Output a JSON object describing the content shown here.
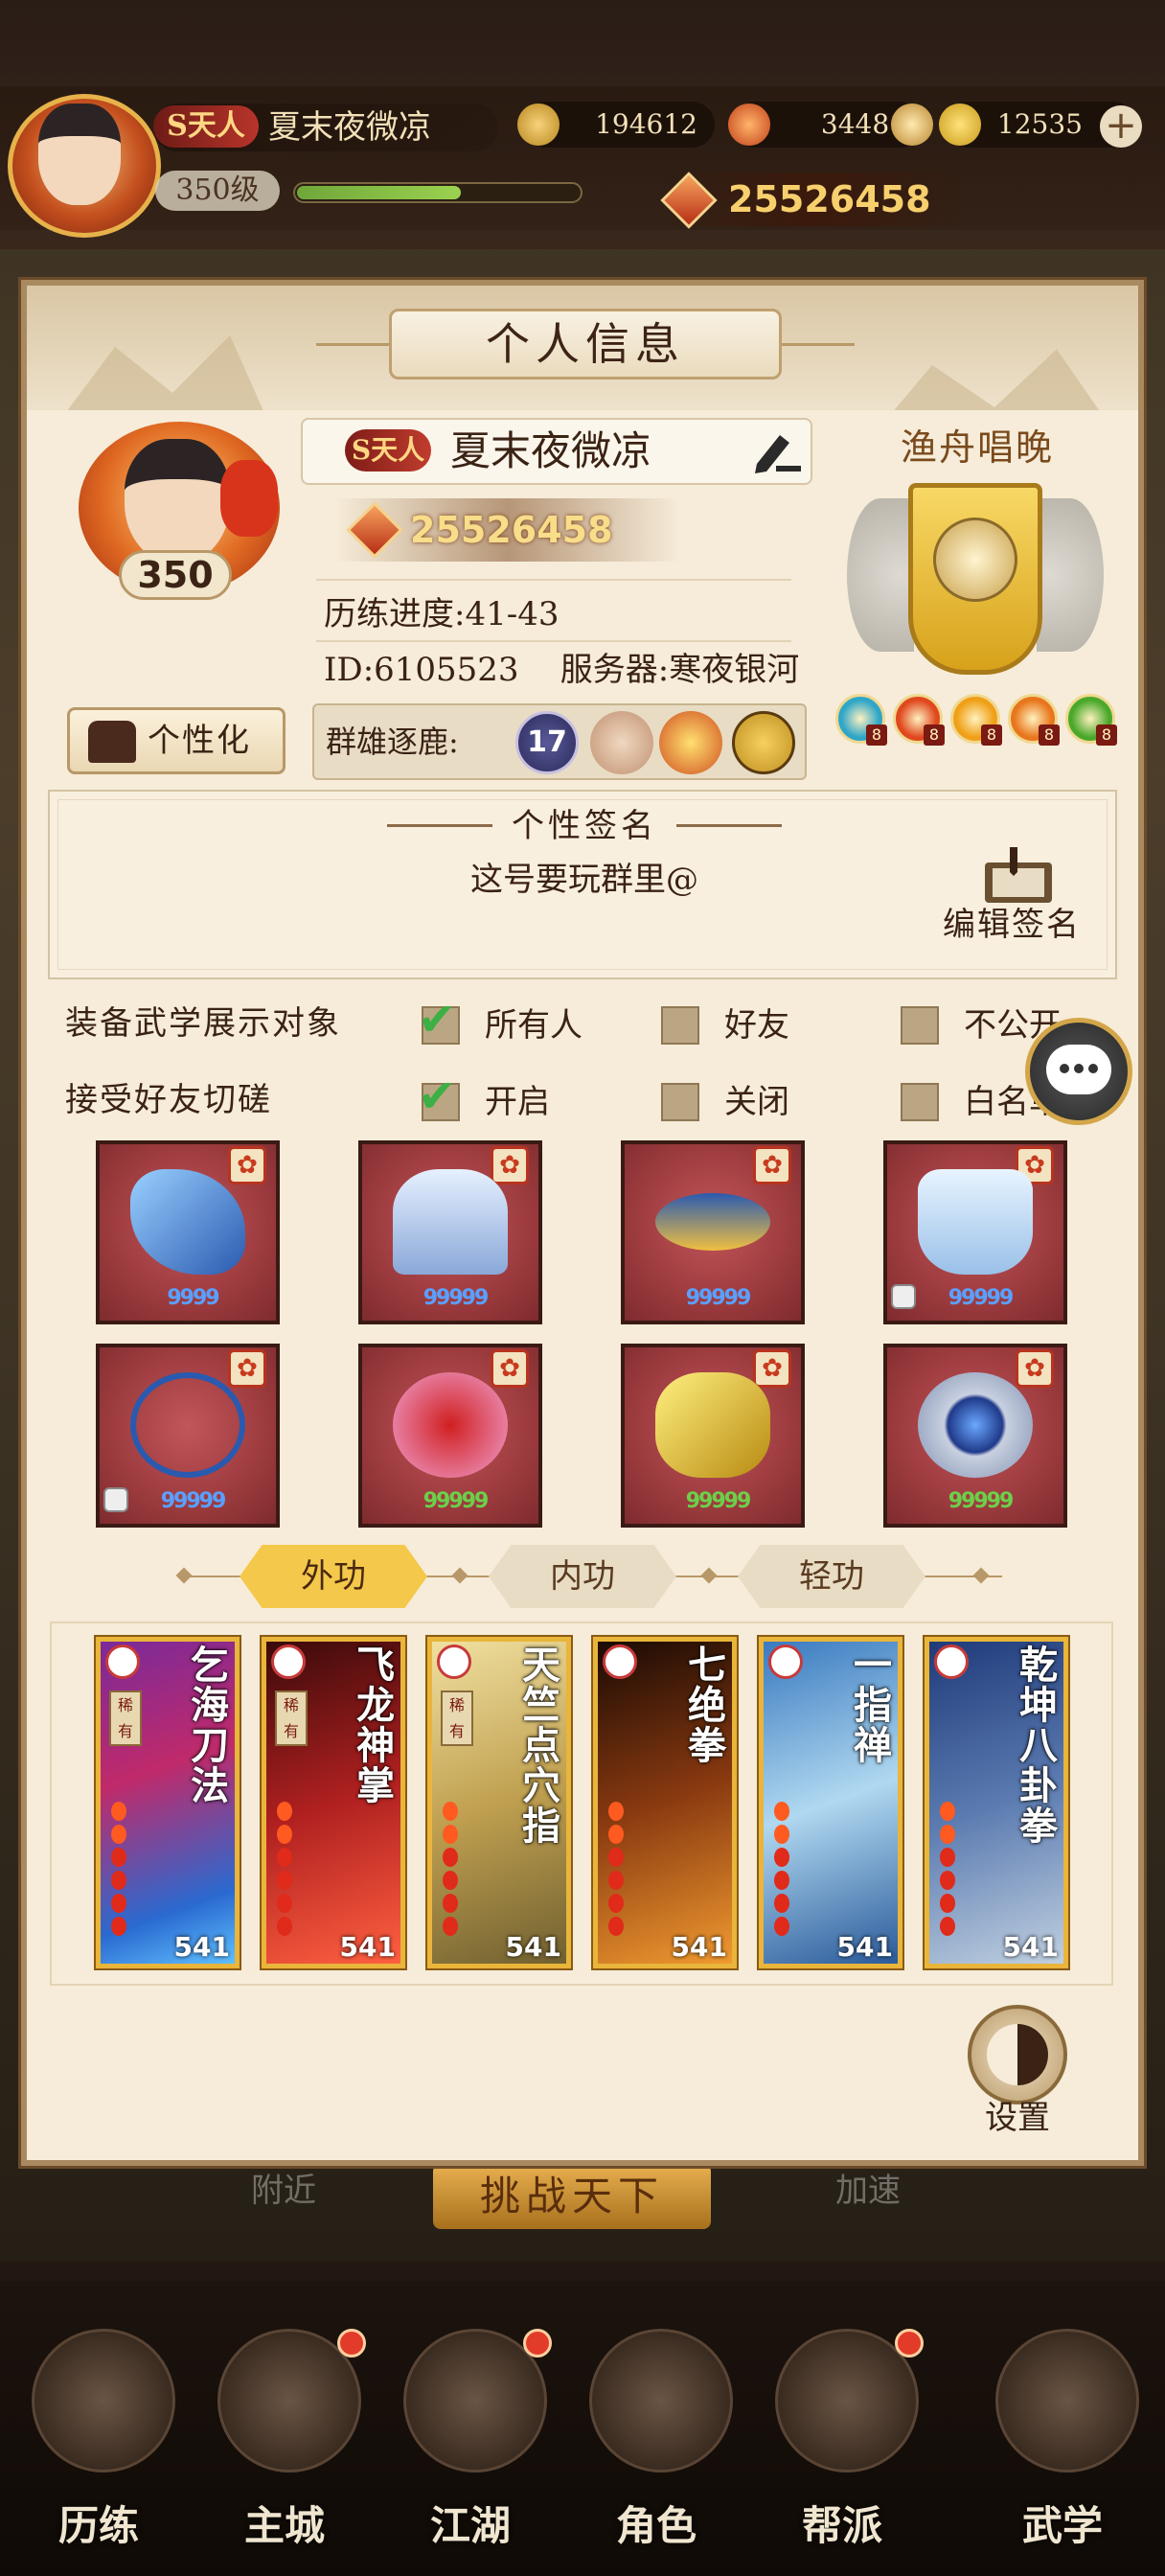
{
  "hud": {
    "rank_badge": "S天人",
    "player_name": "夏末夜微凉",
    "level": "350级",
    "exp_fraction": 0.58,
    "currencies": [
      {
        "icon": "copper-coin-icon",
        "value": "194612"
      },
      {
        "icon": "spirit-flame-icon",
        "value": "34481"
      },
      {
        "icon": "gold-ingot-icon",
        "value": "12535"
      }
    ],
    "power": "25526458"
  },
  "dialog": {
    "title": "个人信息",
    "profile": {
      "level": "350",
      "rank_badge": "S天人",
      "name": "夏末夜微凉",
      "power": "25526458",
      "progress": "历练进度:41-43",
      "id_server": "ID:6105523    服务器:寒夜银河",
      "customize_label": "个性化",
      "arena_label": "群雄逐鹿:",
      "arena_rank": "17"
    },
    "guild": {
      "name": "渔舟唱晚",
      "gems": [
        {
          "color": "#2fa6c8",
          "count": "8"
        },
        {
          "color": "#e0481e",
          "count": "8"
        },
        {
          "color": "#f0a018",
          "count": "8"
        },
        {
          "color": "#e8761c",
          "count": "8"
        },
        {
          "color": "#4aa82a",
          "count": "8"
        }
      ]
    },
    "signature": {
      "title": "个性签名",
      "text": "这号要玩群里@",
      "edit_label": "编辑签名"
    },
    "settings": [
      {
        "label": "装备武学展示对象",
        "options": [
          {
            "text": "所有人",
            "checked": true
          },
          {
            "text": "好友",
            "checked": false
          },
          {
            "text": "不公开",
            "checked": false
          }
        ]
      },
      {
        "label": "接受好友切磋",
        "options": [
          {
            "text": "开启",
            "checked": true
          },
          {
            "text": "关闭",
            "checked": false
          },
          {
            "text": "白名单",
            "checked": false
          }
        ]
      }
    ],
    "equipment": [
      {
        "name": "gauntlet",
        "stars": "9999"
      },
      {
        "name": "robe",
        "stars": "99999"
      },
      {
        "name": "belt",
        "stars": "99999"
      },
      {
        "name": "boots",
        "stars": "99999"
      },
      {
        "name": "necklace",
        "stars": "99999"
      },
      {
        "name": "pendant",
        "stars": "99999"
      },
      {
        "name": "bracer",
        "stars": "99999"
      },
      {
        "name": "ring",
        "stars": "99999"
      }
    ],
    "tabs": [
      "外功",
      "内功",
      "轻功"
    ],
    "active_tab": "外功",
    "skills": [
      {
        "name": "乞海刀法",
        "level": "541",
        "rare": "稀有"
      },
      {
        "name": "飞龙神掌",
        "level": "541",
        "rare": "稀有"
      },
      {
        "name": "天竺点穴指",
        "level": "541",
        "rare": "稀有"
      },
      {
        "name": "七绝拳",
        "level": "541",
        "rare": ""
      },
      {
        "name": "一指禅",
        "level": "541",
        "rare": ""
      },
      {
        "name": "乾坤八卦拳",
        "level": "541",
        "rare": ""
      }
    ],
    "settings_button": "设置"
  },
  "background": {
    "nearby": "附近",
    "challenge": "挑战天下",
    "speedup": "加速"
  },
  "nav": [
    "历练",
    "主城",
    "江湖",
    "角色",
    "帮派",
    "武学"
  ]
}
